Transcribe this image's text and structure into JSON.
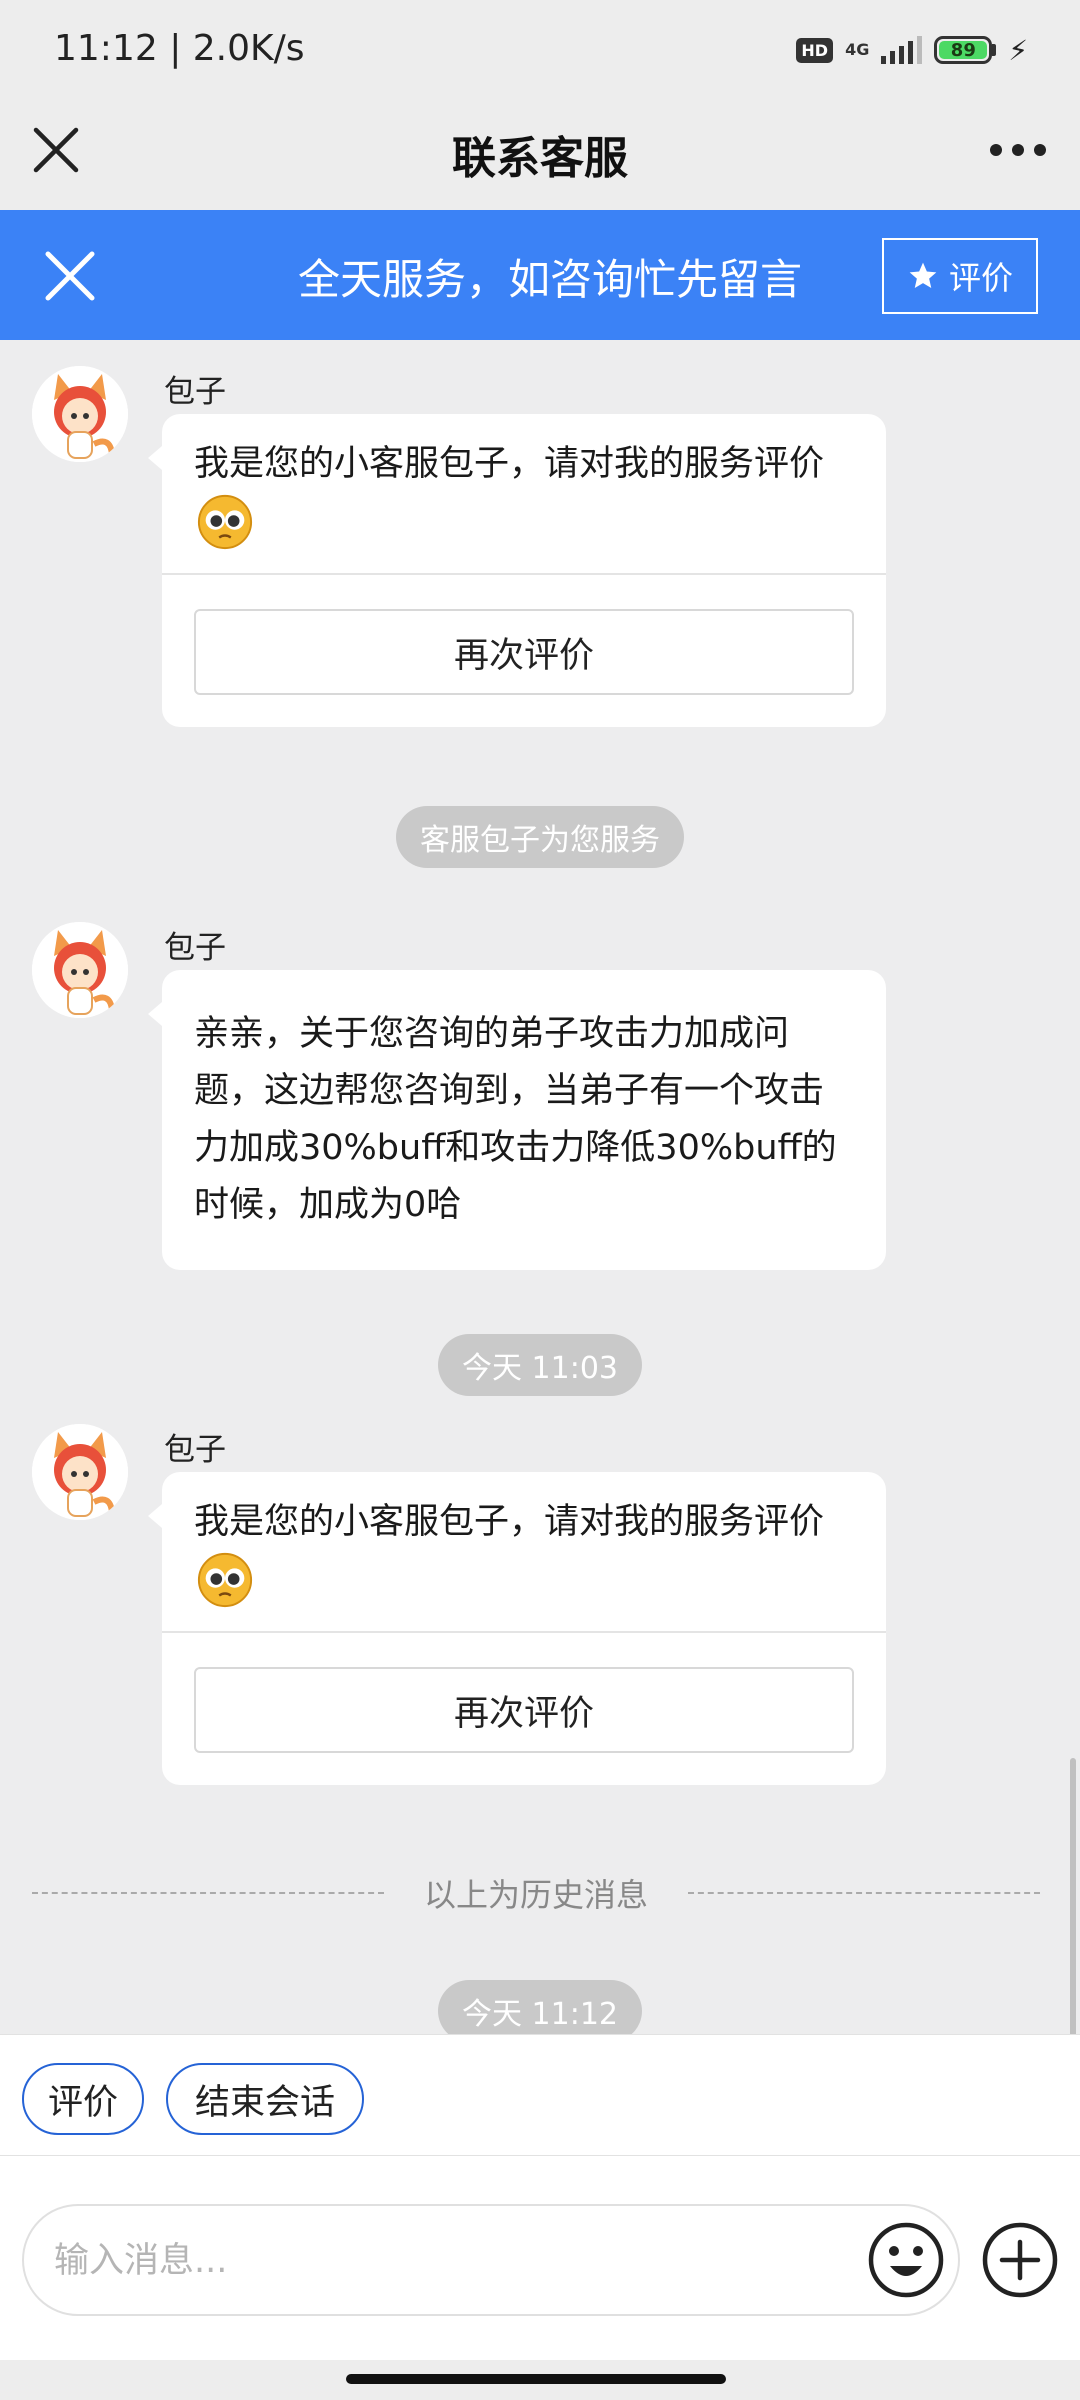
{
  "status_bar": {
    "time_speed": "11:12 | 2.0K/s",
    "hd": "HD",
    "network": "4G",
    "battery": "89"
  },
  "nav": {
    "title": "联系客服"
  },
  "notice": {
    "text": "全天服务，如咨询忙先留言",
    "rate_label": "评价"
  },
  "messages": [
    {
      "sender": "包子",
      "text": "我是您的小客服包子，请对我的服务评价",
      "button": "再次评价"
    },
    {
      "sender": "包子",
      "text": "亲亲，关于您咨询的弟子攻击力加成问题，这边帮您咨询到，当弟子有一个攻击力加成30%buff和攻击力降低30%buff的时候，加成为0哈"
    },
    {
      "sender": "包子",
      "text": "我是您的小客服包子，请对我的服务评价",
      "button": "再次评价"
    }
  ],
  "system": {
    "service_notice": "客服包子为您服务",
    "time1": "今天 11:03",
    "history_label": "以上为历史消息",
    "time2": "今天 11:12"
  },
  "quick_actions": {
    "rate": "评价",
    "end": "结束会话"
  },
  "input": {
    "placeholder": "输入消息...",
    "value": ""
  },
  "colors": {
    "accent": "#3b82f6",
    "quick_border": "#2563d6",
    "background": "#ededee"
  }
}
